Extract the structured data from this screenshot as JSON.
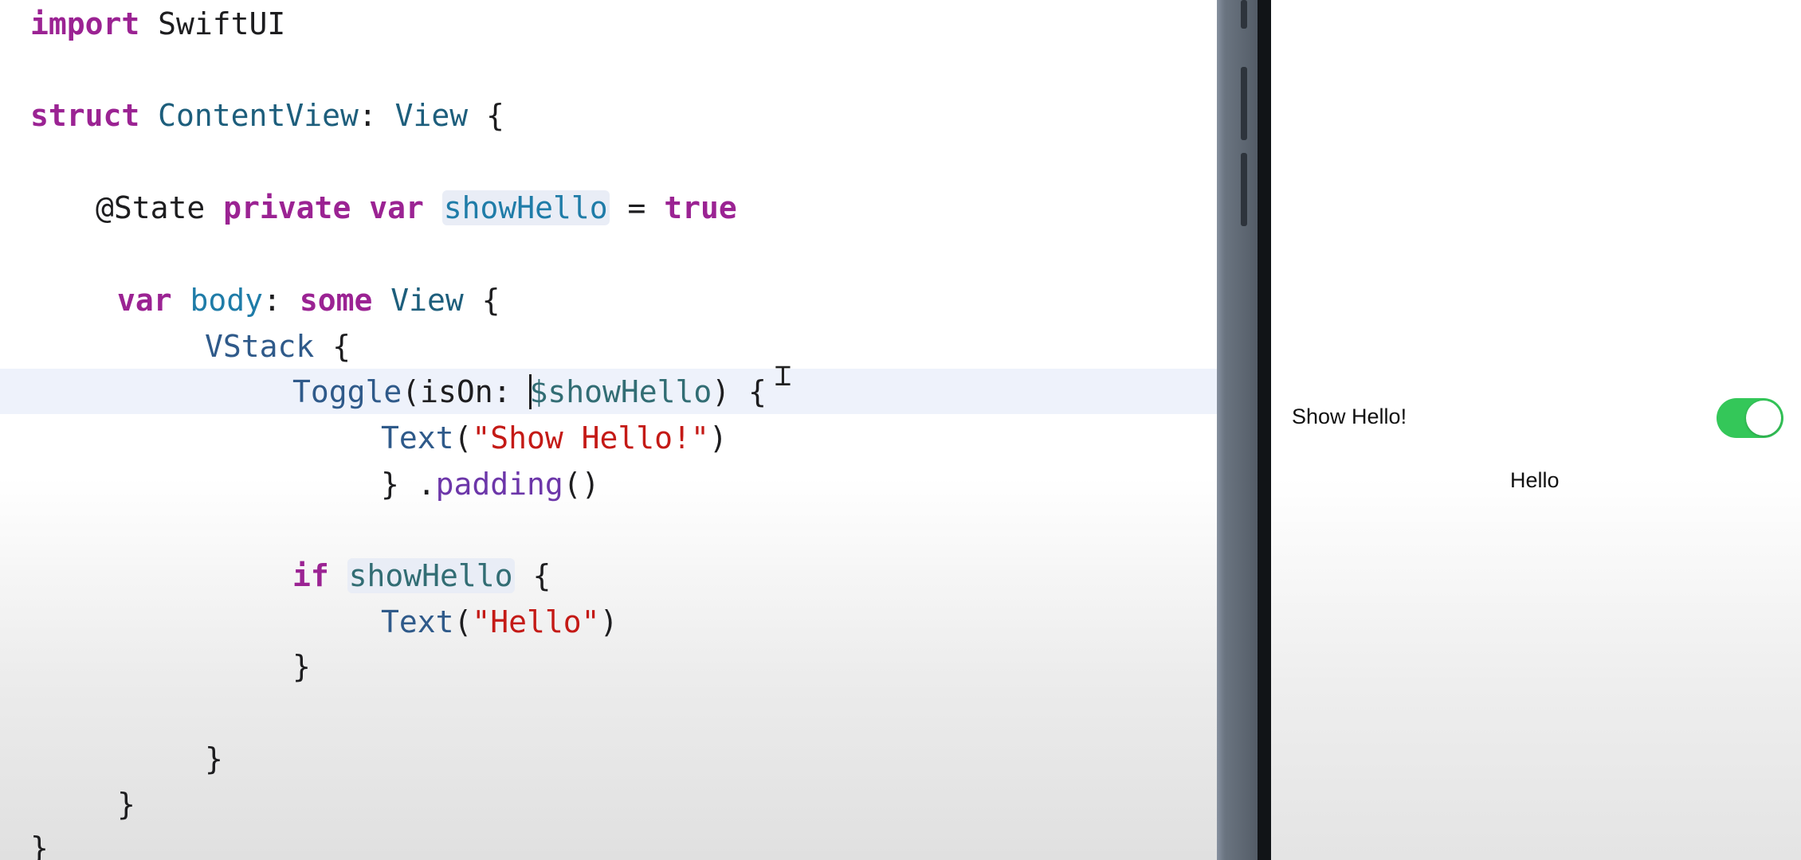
{
  "editor": {
    "lines": {
      "l1": {
        "kw": "import",
        "name": " SwiftUI"
      },
      "l2": {
        "kw": "struct",
        "name": "ContentView",
        "sep": ": ",
        "type": "View",
        "brace": " {"
      },
      "l3": {
        "attr": "@State",
        "kw1": "private",
        "kw2": "var",
        "name": "showHello",
        "eq": " = ",
        "val": "true"
      },
      "l4": {
        "kw": "var",
        "name": "body",
        "sep": ": ",
        "kw2": "some",
        "type": "View",
        "brace": " {"
      },
      "l5": {
        "type": "VStack",
        "brace": " {"
      },
      "l6": {
        "type": "Toggle",
        "open": "(isOn: ",
        "bind": "$showHello",
        "close": ") {"
      },
      "l7": {
        "type": "Text",
        "open": "(",
        "str": "\"Show Hello!\"",
        "close": ")"
      },
      "l8": {
        "brace": "} .",
        "meth": "padding",
        "parens": "()"
      },
      "l9": {
        "kw": "if",
        "name": "showHello",
        "brace": " {"
      },
      "l10": {
        "type": "Text",
        "open": "(",
        "str": "\"Hello\"",
        "close": ")"
      },
      "l11": {
        "brace": "}"
      },
      "l12": {
        "brace": "}"
      },
      "l13": {
        "brace": "}"
      },
      "l14": {
        "brace": "}"
      }
    },
    "cursor_icon": "text-cursor-icon"
  },
  "simulator": {
    "toggle_label": "Show Hello!",
    "toggle_on": true,
    "hello_text": "Hello",
    "toggle_color": "#34c759"
  }
}
